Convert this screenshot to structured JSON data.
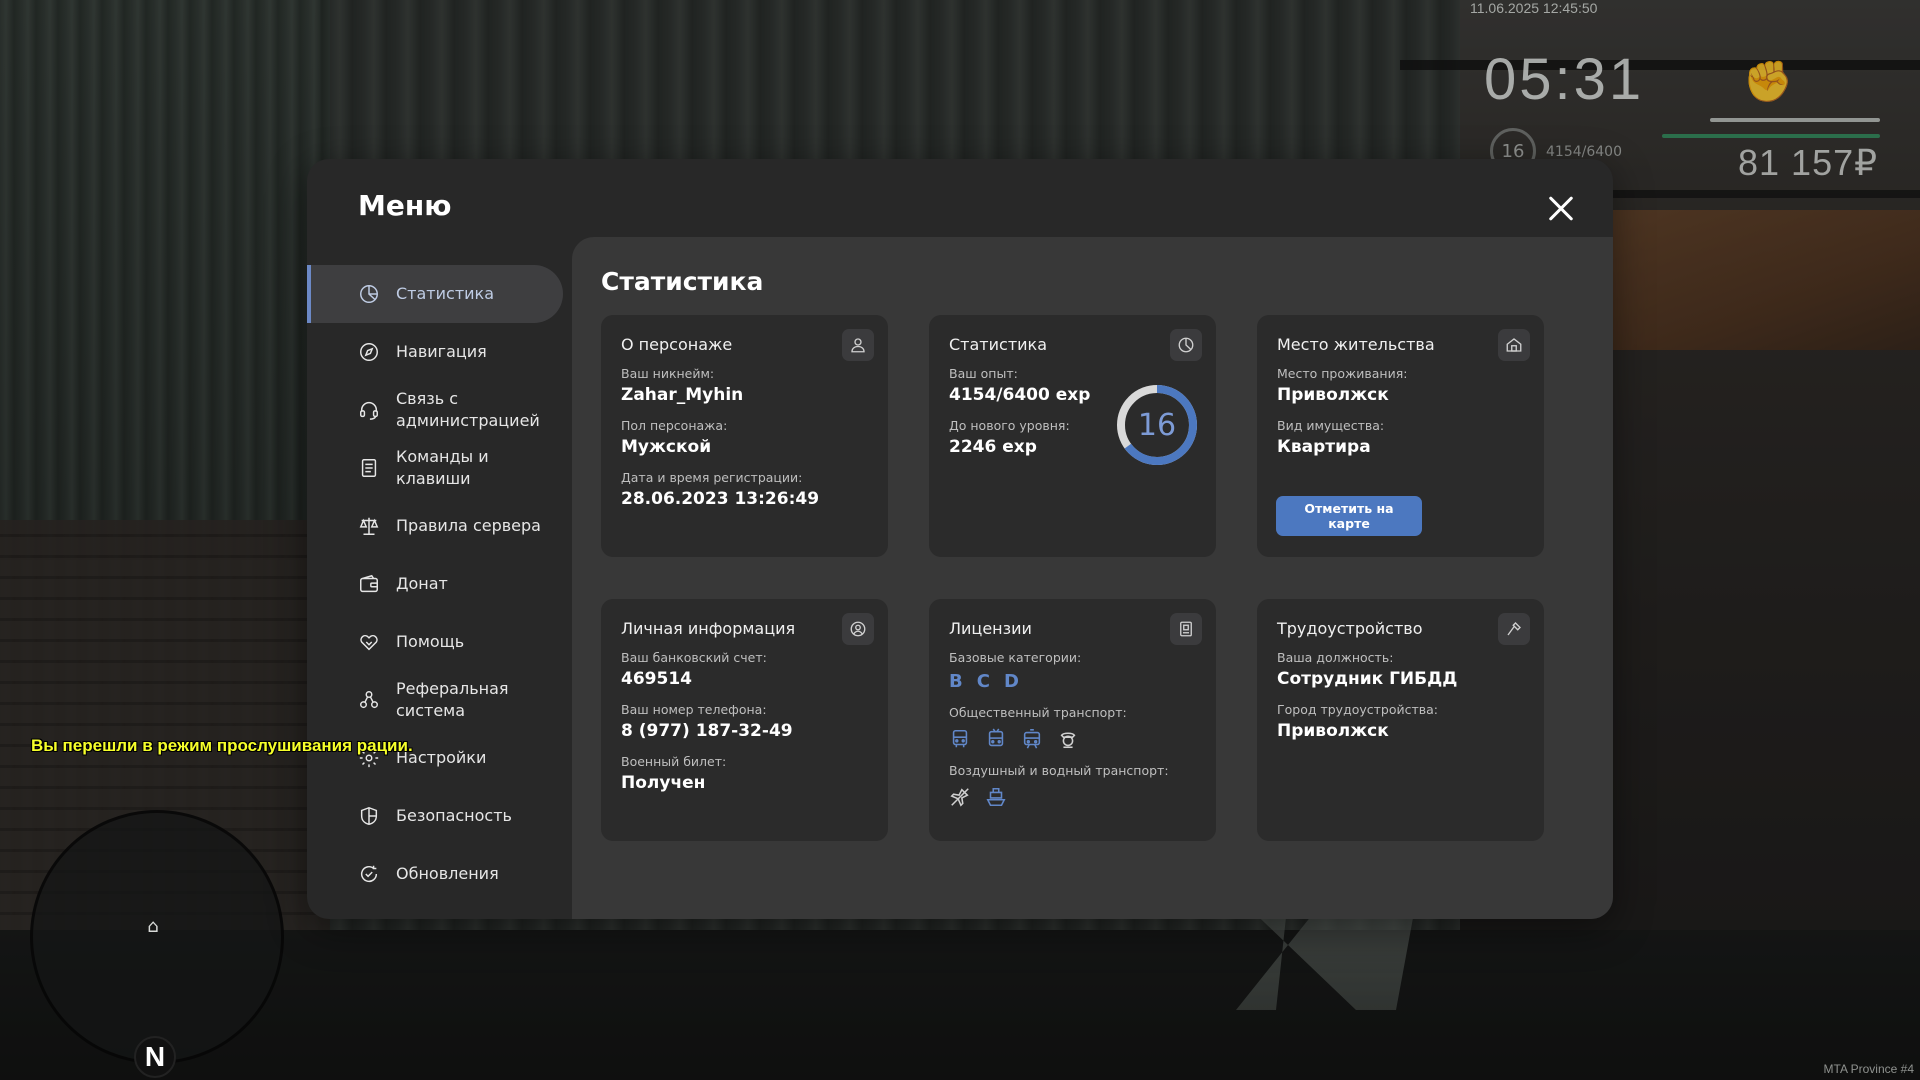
{
  "hud": {
    "datetime": "11.06.2025 12:45:50",
    "clock": "05:31",
    "level": "16",
    "exp": "4154/6400",
    "money": "81 157₽",
    "chat_message": "Вы перешли в режим прослушивания рации.",
    "radar_north": "N",
    "watermark": "MTA Province #4"
  },
  "menu": {
    "title": "Меню",
    "sidebar": [
      {
        "label": "Статистика",
        "icon": "chart-pie-icon",
        "active": true
      },
      {
        "label": "Навигация",
        "icon": "compass-icon",
        "active": false
      },
      {
        "label": "Связь с администрацией",
        "icon": "headset-icon",
        "active": false
      },
      {
        "label": "Команды и клавиши",
        "icon": "document-list-icon",
        "active": false
      },
      {
        "label": "Правила сервера",
        "icon": "scales-icon",
        "active": false
      },
      {
        "label": "Донат",
        "icon": "wallet-icon",
        "active": false
      },
      {
        "label": "Помощь",
        "icon": "handshake-icon",
        "active": false
      },
      {
        "label": "Реферальная система",
        "icon": "referral-icon",
        "active": false
      },
      {
        "label": "Настройки",
        "icon": "gear-icon",
        "active": false
      },
      {
        "label": "Безопасность",
        "icon": "shield-icon",
        "active": false
      },
      {
        "label": "Обновления",
        "icon": "refresh-check-icon",
        "active": false
      }
    ]
  },
  "stats": {
    "title": "Статистика",
    "character": {
      "title": "О персонаже",
      "nickname_label": "Ваш никнейм:",
      "nickname": "Zahar_Myhin",
      "gender_label": "Пол персонажа:",
      "gender": "Мужской",
      "reg_label": "Дата и время регистрации:",
      "reg_date": "28.06.2023 13:26:49"
    },
    "statistics": {
      "title": "Статистика",
      "exp_label": "Ваш опыт:",
      "exp": "4154/6400 exp",
      "next_label": "До нового уровня:",
      "next": "2246 exp",
      "level": "16",
      "progress": 0.649
    },
    "residence": {
      "title": "Место жительства",
      "place_label": "Место проживания:",
      "place": "Приволжск",
      "property_label": "Вид имущества:",
      "property": "Квартира",
      "map_button": "Отметить на карте"
    },
    "personal": {
      "title": "Личная информация",
      "bank_label": "Ваш банковский счет:",
      "bank": "469514",
      "phone_label": "Ваш номер телефона:",
      "phone": "8 (977) 187-32-49",
      "military_label": "Военный билет:",
      "military": "Получен"
    },
    "licenses": {
      "title": "Лицензии",
      "basic_label": "Базовые категории:",
      "categories": [
        "B",
        "C",
        "D"
      ],
      "public_label": "Общественный транспорт:",
      "air_water_label": "Воздушный и водный транспорт:"
    },
    "employment": {
      "title": "Трудоустройство",
      "position_label": "Ваша должность:",
      "position": "Сотрудник ГИБДД",
      "city_label": "Город трудоустройства:",
      "city": "Приволжск"
    }
  },
  "colors": {
    "accent": "#4c78c0",
    "accent_text": "#7d9bd6",
    "card_bg": "#2b2b2b",
    "panel_bg": "#383838",
    "window_bg": "#282828",
    "chat_yellow": "#f6ff2a"
  }
}
